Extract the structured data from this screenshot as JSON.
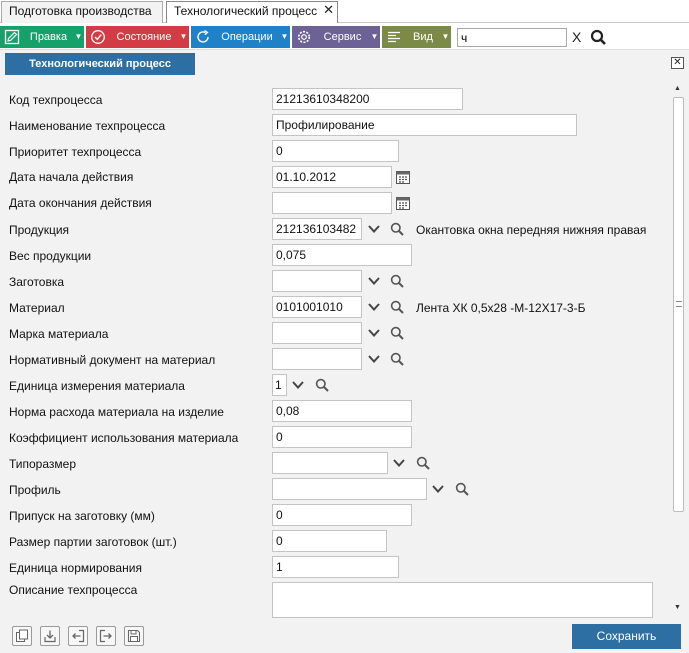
{
  "tabs": [
    {
      "label": "Подготовка производства"
    },
    {
      "label": "Технологический процесс",
      "close": "✕"
    }
  ],
  "toolbar": {
    "buttons": [
      {
        "label": "Правка",
        "icon": "edit-icon",
        "color": "#16a06a"
      },
      {
        "label": "Состояние",
        "icon": "check-circle-icon",
        "color": "#d33c44"
      },
      {
        "label": "Операции",
        "icon": "refresh-icon",
        "color": "#1f82c8"
      },
      {
        "label": "Сервис",
        "icon": "gear-icon",
        "color": "#6d6295"
      },
      {
        "label": "Вид",
        "icon": "list-icon",
        "color": "#7b8b47"
      }
    ],
    "search_value": "ч",
    "clear_label": "X"
  },
  "panel": {
    "title": "Технологический процесс",
    "close": "✕"
  },
  "form": {
    "fields": [
      {
        "label": "Код техпроцесса",
        "value": "21213610348200"
      },
      {
        "label": "Наименование техпроцесса",
        "value": "Профилирование"
      },
      {
        "label": "Приоритет техпроцесса",
        "value": "0"
      },
      {
        "label": "Дата начала действия",
        "value": "01.10.2012"
      },
      {
        "label": "Дата окончания действия",
        "value": ""
      },
      {
        "label": "Продукция",
        "value": "212136103482",
        "description": "Окантовка окна передняя нижняя правая"
      },
      {
        "label": "Вес продукции",
        "value": "0,075"
      },
      {
        "label": "Заготовка",
        "value": ""
      },
      {
        "label": "Материал",
        "value": "0101001010",
        "description": "Лента ХК 0,5х28 -М-12Х17-3-Б"
      },
      {
        "label": "Марка материала",
        "value": ""
      },
      {
        "label": "Нормативный документ на материал",
        "value": ""
      },
      {
        "label": "Единица измерения материала",
        "value": "1"
      },
      {
        "label": "Норма расхода материала на изделие",
        "value": "0,08"
      },
      {
        "label": "Коэффициент использования материала",
        "value": "0"
      },
      {
        "label": "Типоразмер",
        "value": ""
      },
      {
        "label": "Профиль",
        "value": ""
      },
      {
        "label": "Припуск на заготовку (мм)",
        "value": "0"
      },
      {
        "label": "Размер партии заготовок (шт.)",
        "value": "0"
      },
      {
        "label": "Единица нормирования",
        "value": "1"
      },
      {
        "label": "Описание техпроцесса",
        "value": ""
      }
    ]
  },
  "footer": {
    "icons": [
      "copy-icon",
      "import-icon",
      "back-icon",
      "export-icon",
      "save-disk-icon"
    ],
    "save_label": "Сохранить"
  }
}
